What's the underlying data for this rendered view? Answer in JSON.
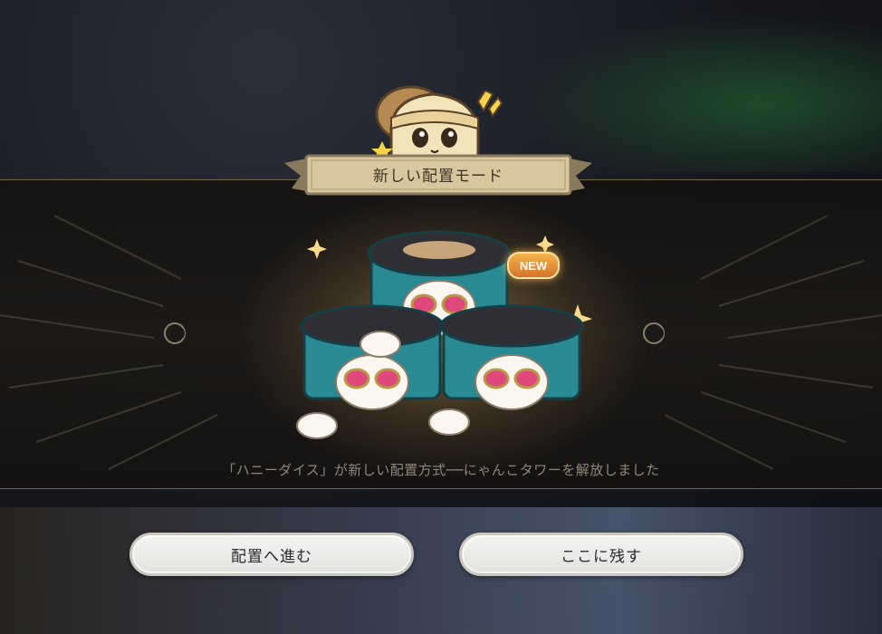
{
  "dialog": {
    "title": "新しい配置モード",
    "badge": "NEW",
    "message": "「ハニーダイス」が新しい配置方式──にゃんこタワーを解放しました"
  },
  "buttons": {
    "proceed_label": "配置へ進む",
    "stay_label": "ここに残す"
  },
  "icons": {
    "mascot": "mascot-icon",
    "moon": "crescent-moon-icon",
    "sparkle": "sparkle-icon",
    "tower": "cat-tower-icon"
  },
  "colors": {
    "tower_teal": "#2a8a94",
    "badge_orange": "#e38e35",
    "banner_tan": "#cdb88d",
    "message_text": "#8f877a"
  }
}
